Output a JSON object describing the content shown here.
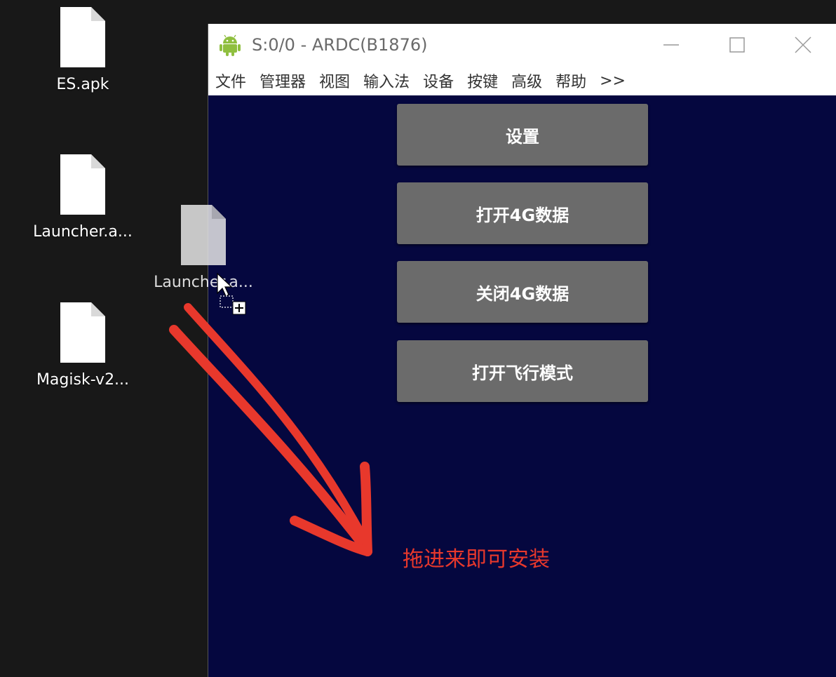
{
  "desktop": {
    "icons": [
      {
        "label": "ES.apk"
      },
      {
        "label": "Launcher.a..."
      },
      {
        "label": "Magisk-v2..."
      }
    ],
    "drag_ghost": {
      "label": "Launcher.a..."
    }
  },
  "window": {
    "title": "S:0/0 - ARDC(B1876)",
    "menu": [
      "文件",
      "管理器",
      "视图",
      "输入法",
      "设备",
      "按键",
      "高级",
      "帮助",
      ">>"
    ],
    "controls": {
      "minimize_icon": "minimize-icon",
      "maximize_icon": "maximize-icon",
      "close_icon": "close-icon"
    }
  },
  "device": {
    "buttons": [
      {
        "label": "设置"
      },
      {
        "label": "打开4G数据"
      },
      {
        "label": "关闭4G数据"
      },
      {
        "label": "打开飞行模式"
      }
    ],
    "background_color": "#05073f",
    "button_color": "#6b6b6b"
  },
  "annotation": {
    "text": "拖进来即可安装",
    "color": "#e8382c"
  }
}
